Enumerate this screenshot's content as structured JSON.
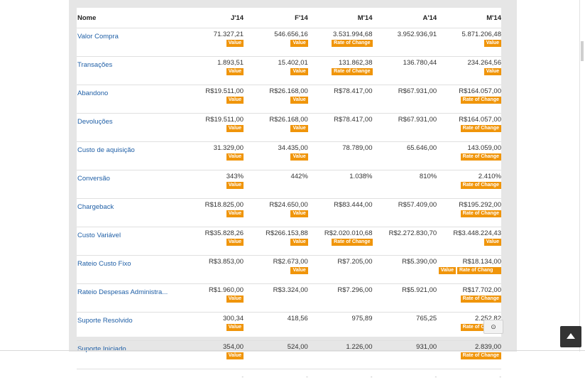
{
  "table": {
    "headers": [
      "Nome",
      "J'14",
      "F'14",
      "M'14",
      "A'14",
      "M'14"
    ],
    "rows": [
      {
        "name": "Valor Compra",
        "cells": [
          {
            "v": "71.327,21",
            "b": [
              "Value"
            ]
          },
          {
            "v": "546.656,16",
            "b": [
              "Value"
            ]
          },
          {
            "v": "3.531.994,68",
            "b": [
              "Rate of Change"
            ]
          },
          {
            "v": "3.952.936,91",
            "b": []
          },
          {
            "v": "5.871.206,48",
            "b": [
              "Value"
            ]
          }
        ]
      },
      {
        "name": "Transações",
        "cells": [
          {
            "v": "1.893,51",
            "b": [
              "Value"
            ]
          },
          {
            "v": "15.402,01",
            "b": [
              "Value"
            ]
          },
          {
            "v": "131.862,38",
            "b": [
              "Rate of Change"
            ]
          },
          {
            "v": "136.780,44",
            "b": []
          },
          {
            "v": "234.264,56",
            "b": [
              "Value"
            ]
          }
        ]
      },
      {
        "name": "Abandono",
        "cells": [
          {
            "v": "R$19.511,00",
            "b": [
              "Value"
            ]
          },
          {
            "v": "R$26.168,00",
            "b": [
              "Value"
            ]
          },
          {
            "v": "R$78.417,00",
            "b": []
          },
          {
            "v": "R$67.931,00",
            "b": []
          },
          {
            "v": "R$164.057,00",
            "b": [
              "Rate of Change"
            ]
          }
        ]
      },
      {
        "name": "Devoluções",
        "cells": [
          {
            "v": "R$19.511,00",
            "b": [
              "Value"
            ]
          },
          {
            "v": "R$26.168,00",
            "b": [
              "Value"
            ]
          },
          {
            "v": "R$78.417,00",
            "b": []
          },
          {
            "v": "R$67.931,00",
            "b": []
          },
          {
            "v": "R$164.057,00",
            "b": [
              "Rate of Change"
            ]
          }
        ]
      },
      {
        "name": "Custo de aquisição",
        "cells": [
          {
            "v": "31.329,00",
            "b": [
              "Value"
            ]
          },
          {
            "v": "34.435,00",
            "b": [
              "Value"
            ]
          },
          {
            "v": "78.789,00",
            "b": []
          },
          {
            "v": "65.646,00",
            "b": []
          },
          {
            "v": "143.059,00",
            "b": [
              "Rate of Change"
            ]
          }
        ]
      },
      {
        "name": "Conversão",
        "cells": [
          {
            "v": "343%",
            "b": [
              "Value"
            ]
          },
          {
            "v": "442%",
            "b": []
          },
          {
            "v": "1.038%",
            "b": []
          },
          {
            "v": "810%",
            "b": []
          },
          {
            "v": "2.410%",
            "b": [
              "Rate of Change"
            ]
          }
        ]
      },
      {
        "name": "Chargeback",
        "cells": [
          {
            "v": "R$18.825,00",
            "b": [
              "Value"
            ]
          },
          {
            "v": "R$24.650,00",
            "b": [
              "Value"
            ]
          },
          {
            "v": "R$83.444,00",
            "b": []
          },
          {
            "v": "R$57.409,00",
            "b": []
          },
          {
            "v": "R$195.292,00",
            "b": [
              "Rate of Change"
            ]
          }
        ]
      },
      {
        "name": "Custo Variável",
        "cells": [
          {
            "v": "R$35.828,26",
            "b": [
              "Value"
            ]
          },
          {
            "v": "R$266.153,88",
            "b": [
              "Value"
            ]
          },
          {
            "v": "R$2.020.010,68",
            "b": [
              "Rate of Change"
            ]
          },
          {
            "v": "R$2.272.830,70",
            "b": []
          },
          {
            "v": "R$3.448.224,43",
            "b": [
              "Value"
            ]
          }
        ]
      },
      {
        "name": "Rateio Custo Fixo",
        "cells": [
          {
            "v": "R$3.853,00",
            "b": []
          },
          {
            "v": "R$2.673,00",
            "b": [
              "Value"
            ]
          },
          {
            "v": "R$7.205,00",
            "b": []
          },
          {
            "v": "R$5.390,00",
            "b": []
          },
          {
            "v": "R$18.134,00",
            "b": [
              "Value",
              "Rate of Chang"
            ]
          }
        ]
      },
      {
        "name": "Rateio Despesas Administra...",
        "cells": [
          {
            "v": "R$1.960,00",
            "b": [
              "Value"
            ]
          },
          {
            "v": "R$3.324,00",
            "b": []
          },
          {
            "v": "R$7.296,00",
            "b": []
          },
          {
            "v": "R$5.921,00",
            "b": []
          },
          {
            "v": "R$17.702,00",
            "b": [
              "Rate of Change"
            ]
          }
        ]
      },
      {
        "name": "Suporte Resolvido",
        "cells": [
          {
            "v": "300,34",
            "b": [
              "Value"
            ]
          },
          {
            "v": "418,56",
            "b": []
          },
          {
            "v": "975,89",
            "b": []
          },
          {
            "v": "765,25",
            "b": []
          },
          {
            "v": "2.252,82",
            "b": [
              "Rate of Change"
            ]
          }
        ]
      },
      {
        "name": "Suporte Iniciado",
        "cells": [
          {
            "v": "354,00",
            "b": [
              "Value"
            ]
          },
          {
            "v": "524,00",
            "b": []
          },
          {
            "v": "1.226,00",
            "b": []
          },
          {
            "v": "931,00",
            "b": []
          },
          {
            "v": "2.839,00",
            "b": [
              "Rate of Change"
            ]
          }
        ]
      }
    ],
    "empty_row": [
      "-",
      "-",
      "-",
      "-",
      "-"
    ]
  },
  "colors": {
    "badge": "#f0950a",
    "link": "#1f5fa6"
  },
  "icons": {
    "collapse": "collapse-icon",
    "back_to_top": "arrow-up-icon"
  }
}
